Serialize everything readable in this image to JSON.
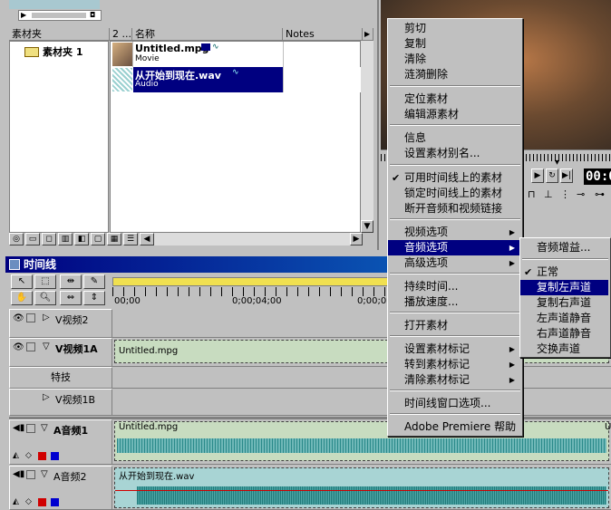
{
  "bin": {
    "headers": {
      "bin": "素材夹",
      "col2": "2 ...",
      "name": "名称",
      "notes": "Notes"
    },
    "folder": "素材夹 1",
    "clips": [
      {
        "name": "Untitled.mpg",
        "type": "Movie"
      },
      {
        "name": "从开始到现在.wav",
        "type": "Audio"
      }
    ]
  },
  "monitor": {
    "timecode": "00:0"
  },
  "timeline": {
    "title": "时间线",
    "ruler": [
      "00;00",
      "0;00;04;00",
      "0;00;0"
    ],
    "tracks": {
      "v2": "V视频2",
      "v1a": "V视频1A",
      "fx": "特技",
      "v1b": "V视频1B",
      "a1": "A音频1",
      "a2": "A音频2"
    },
    "clips": {
      "v1a": "Untitled.mpg",
      "a1": "Untitled.mpg",
      "a1_end": "U",
      "a2": "从开始到现在.wav"
    }
  },
  "context_menu": {
    "items": [
      {
        "label": "剪切"
      },
      {
        "label": "复制"
      },
      {
        "label": "清除"
      },
      {
        "label": "涟漪删除"
      },
      {
        "label": "定位素材"
      },
      {
        "label": "编辑源素材"
      },
      {
        "label": "信息"
      },
      {
        "label": "设置素材别名..."
      },
      {
        "label": "可用时间线上的素材",
        "checked": true
      },
      {
        "label": "锁定时间线上的素材"
      },
      {
        "label": "断开音频和视频链接"
      },
      {
        "label": "视频选项",
        "submenu": true
      },
      {
        "label": "音频选项",
        "submenu": true,
        "selected": true
      },
      {
        "label": "高级选项",
        "submenu": true
      },
      {
        "label": "持续时间..."
      },
      {
        "label": "播放速度..."
      },
      {
        "label": "打开素材"
      },
      {
        "label": "设置素材标记",
        "submenu": true
      },
      {
        "label": "转到素材标记",
        "submenu": true
      },
      {
        "label": "清除素材标记",
        "submenu": true
      },
      {
        "label": "时间线窗口选项..."
      },
      {
        "label": "Adobe Premiere 帮助"
      }
    ]
  },
  "audio_submenu": {
    "items": [
      {
        "label": "音频增益..."
      },
      {
        "label": "正常",
        "checked": true
      },
      {
        "label": "复制左声道",
        "selected": true
      },
      {
        "label": "复制右声道"
      },
      {
        "label": "左声道静音"
      },
      {
        "label": "右声道静音"
      },
      {
        "label": "交换声道"
      }
    ]
  }
}
